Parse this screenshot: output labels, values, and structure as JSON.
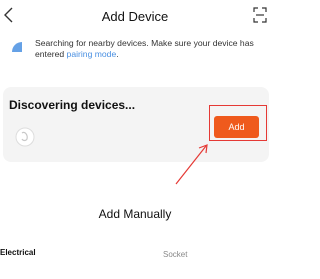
{
  "header": {
    "title": "Add Device",
    "back_icon": "chevron-left-icon",
    "scan_icon": "scan-icon"
  },
  "notice": {
    "text": "Searching for nearby devices. Make sure your device has entered ",
    "link": "pairing mode",
    "suffix": "."
  },
  "discovery": {
    "title": "Discovering devices...",
    "add_label": "Add",
    "accent_color": "#ef5a1d",
    "highlight_color": "#e53935"
  },
  "manual": {
    "title": "Add Manually",
    "category": "Electrical",
    "item": "Socket"
  }
}
